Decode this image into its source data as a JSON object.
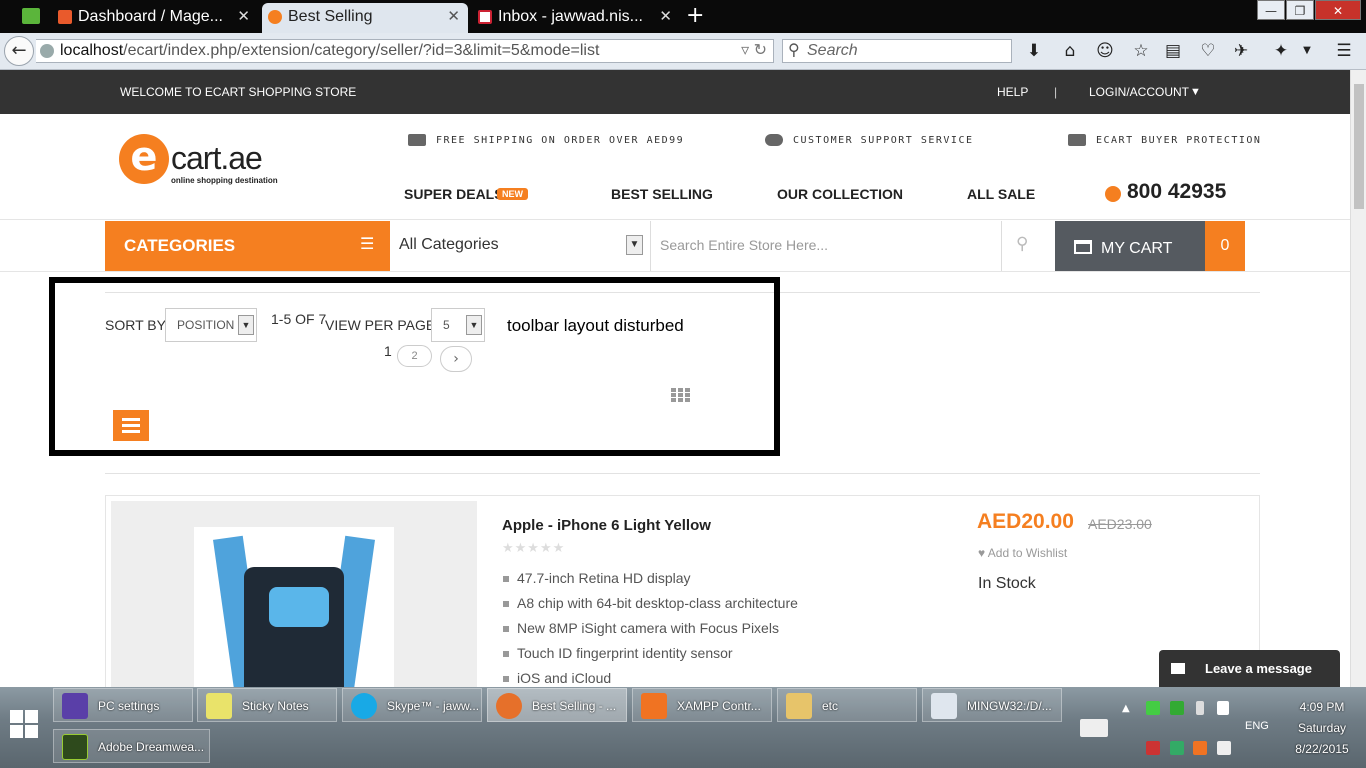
{
  "browser": {
    "tabs": [
      {
        "title": "Dashboard / Mage...",
        "active": false
      },
      {
        "title": "Best Selling",
        "active": true
      },
      {
        "title": "Inbox - jawwad.nis...",
        "active": false
      }
    ],
    "new_tab": "+",
    "url_host": "localhost",
    "url_path": "/ecart/index.php/extension/category/seller/?id=3&limit=5&mode=list",
    "search_placeholder": "Search",
    "window_buttons": {
      "minimize": "—",
      "maximize": "❐",
      "close": "✕"
    }
  },
  "topbar": {
    "welcome": "WELCOME TO ECART SHOPPING STORE",
    "help": "HELP",
    "separator": "|",
    "login": "LOGIN/ACCOUNT"
  },
  "header": {
    "logo_letter": "e",
    "logo_brand": "cart.ae",
    "logo_tagline": "online shopping destination",
    "promos": [
      "FREE SHIPPING ON ORDER OVER AED99",
      "CUSTOMER SUPPORT SERVICE",
      "ECART BUYER PROTECTION"
    ],
    "nav": [
      "SUPER DEALS",
      "BEST SELLING",
      "OUR COLLECTION",
      "ALL SALE"
    ],
    "new_badge": "NEW",
    "phone": "800 42935"
  },
  "category_bar": {
    "categories_label": "CATEGORIES",
    "select_value": "All Categories",
    "search_placeholder": "Search Entire Store Here...",
    "cart_label": "MY CART",
    "cart_count": "0"
  },
  "toolbar": {
    "sort_label": "SORT BY:",
    "sort_value": "POSITION",
    "count_text": "1-5 OF 7",
    "per_page_label": "VIEW PER PAGE:",
    "per_page_value": "5",
    "current_page": "1",
    "next_page": "2",
    "annotation": "toolbar layout disturbed"
  },
  "product": {
    "name": "Apple - iPhone 6 Light Yellow",
    "rating_stars": "★★★★★",
    "features": [
      "47.7-inch Retina HD display",
      "A8 chip with 64-bit desktop-class architecture",
      "New 8MP iSight camera with Focus Pixels",
      "Touch ID fingerprint identity sensor",
      "iOS and iCloud"
    ],
    "price": "AED20.00",
    "old_price": "AED23.00",
    "wishlist": "Add to Wishlist",
    "stock": "In Stock"
  },
  "chat": {
    "label": "Leave a message"
  },
  "taskbar": {
    "items": [
      {
        "label": "PC settings",
        "color": "#5a3fa8"
      },
      {
        "label": "Sticky Notes",
        "color": "#e9e36a"
      },
      {
        "label": "Skype™ - jaww...",
        "color": "#18a9e6"
      },
      {
        "label": "Best Selling - ...",
        "color": "#e6702a"
      },
      {
        "label": "XAMPP Contr...",
        "color": "#f07322"
      },
      {
        "label": "etc",
        "color": "#e7c46a"
      },
      {
        "label": "MINGW32:/D/...",
        "color": "#dfe6ee"
      },
      {
        "label": "Adobe Dreamwea...",
        "color": "#2e4a1c"
      }
    ],
    "lang": "ENG",
    "time": "4:09 PM",
    "day": "Saturday",
    "date": "8/22/2015"
  }
}
